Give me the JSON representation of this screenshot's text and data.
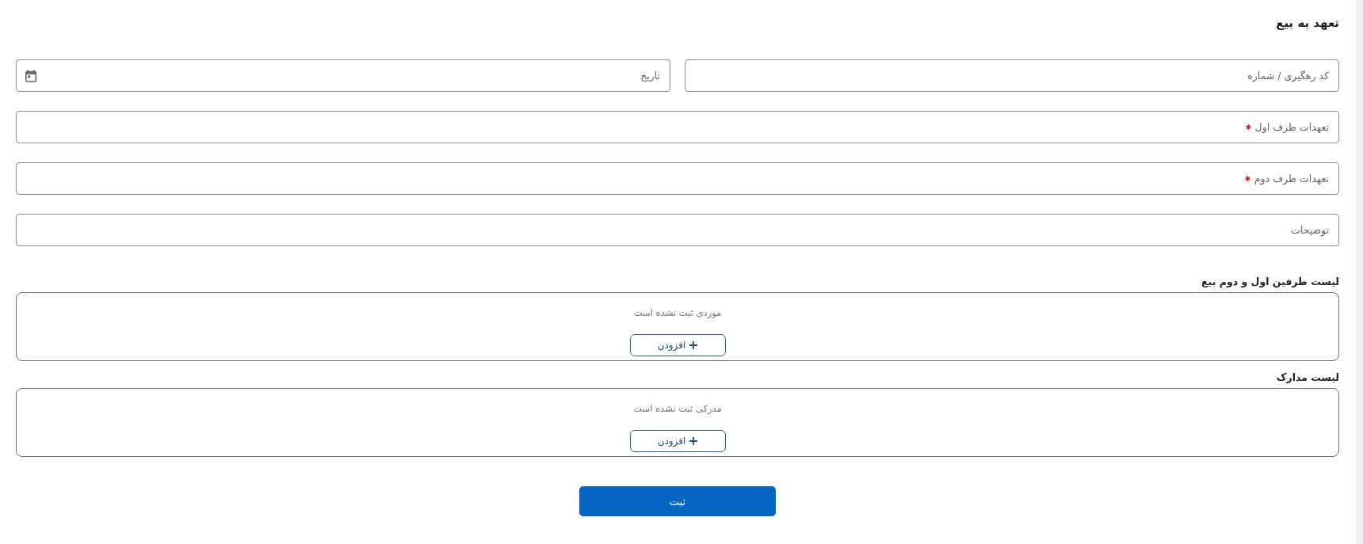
{
  "title": "تعهد به بیع",
  "form_rows": [
    {
      "fields": [
        {
          "kind": "text",
          "label": "کد رهگیری / شماره",
          "required": false
        },
        {
          "kind": "date",
          "label": "تاریخ",
          "required": false
        }
      ]
    },
    {
      "fields": [
        {
          "kind": "text",
          "label": "تعهدات طرف اول",
          "required": true
        }
      ]
    },
    {
      "fields": [
        {
          "kind": "text",
          "label": "تعهدات طرف دوم",
          "required": true
        }
      ]
    },
    {
      "fields": [
        {
          "kind": "text",
          "label": "توضیحات",
          "required": false
        }
      ]
    }
  ],
  "lists": [
    {
      "title": "لیست طرفین اول و دوم بیع",
      "empty_text": "موردی ثبت نشده است",
      "add_button": "افزودن"
    },
    {
      "title": "لیست مدارک",
      "empty_text": "مدرکی ثبت نشده است",
      "add_button": "افزودن"
    }
  ],
  "submit_button": "ثبت"
}
